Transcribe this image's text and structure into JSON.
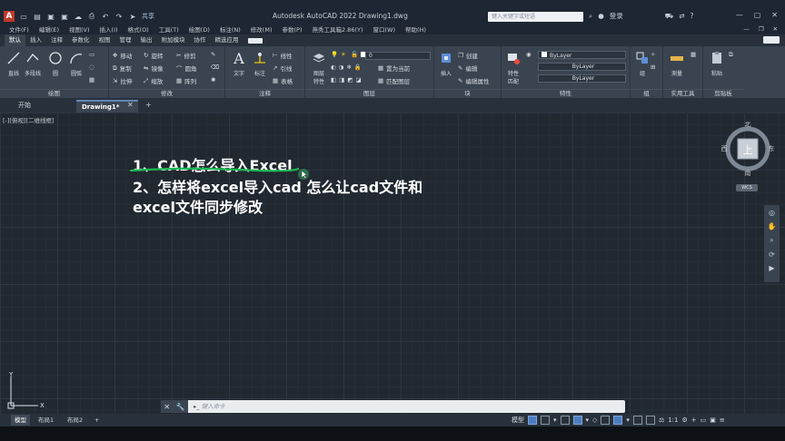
{
  "titlebar": {
    "share": "共享",
    "app_title": "Autodesk AutoCAD 2022   Drawing1.dwg",
    "search_placeholder": "键入关键字或短语",
    "login": "登录",
    "help": "?"
  },
  "menu": [
    "文件(F)",
    "编辑(E)",
    "视图(V)",
    "插入(I)",
    "格式(O)",
    "工具(T)",
    "绘图(D)",
    "标注(N)",
    "修改(M)",
    "参数(P)",
    "燕秀工具箱2.86(Y)",
    "窗口(W)",
    "帮助(H)"
  ],
  "ribbon_tabs": [
    "默认",
    "插入",
    "注释",
    "参数化",
    "视图",
    "管理",
    "输出",
    "附加模块",
    "协作",
    "精选应用"
  ],
  "ribbon": {
    "draw": {
      "title": "绘图",
      "line": "直线",
      "polyline": "多段线",
      "circle": "圆",
      "arc": "圆弧"
    },
    "modify": {
      "title": "修改",
      "move": "移动",
      "rotate": "旋转",
      "trim": "修剪",
      "copy": "复制",
      "mirror": "镜像",
      "fillet": "圆角",
      "stretch": "拉伸",
      "scale": "缩放",
      "array": "阵列"
    },
    "annotation": {
      "title": "注释",
      "text": "文字",
      "dimension": "标注",
      "linear": "线性",
      "leader": "引线",
      "table": "表格"
    },
    "layers": {
      "title": "图层",
      "properties_a": "图层",
      "properties_b": "特性",
      "layer_value": "0",
      "set_current": "置为当前",
      "match_layer": "匹配图层"
    },
    "block": {
      "title": "块",
      "insert": "插入",
      "create": "创建",
      "edit": "编辑",
      "edit_attr": "编辑属性"
    },
    "properties": {
      "title": "特性",
      "match_a": "特性",
      "match_b": "匹配",
      "bylayer1": "ByLayer",
      "bylayer2": "ByLayer",
      "bylayer3": "ByLayer"
    },
    "groups": {
      "title": "组",
      "group": "组"
    },
    "utilities": {
      "title": "实用工具",
      "measure": "测量"
    },
    "clipboard": {
      "title": "剪贴板",
      "paste": "粘贴"
    }
  },
  "doc_tabs": {
    "start": "开始",
    "drawing": "Drawing1*"
  },
  "viewport_label": "[-][俯视][二维线框]",
  "content": {
    "line1": "1、CAD怎么导入Excel",
    "line2": "2、怎样将excel导入cad 怎么让cad文件和",
    "line3": "excel文件同步修改"
  },
  "viewcube": {
    "north": "北",
    "south": "南",
    "east": "东",
    "west": "西",
    "face": "上",
    "wcs": "WCS"
  },
  "ucs": {
    "x": "X",
    "y": "Y"
  },
  "command": {
    "placeholder": "键入命令"
  },
  "layout_tabs": [
    "模型",
    "布局1",
    "布局2"
  ],
  "status": {
    "model": "模型",
    "scale": "1:1"
  },
  "colors": {
    "canvas": "#212830",
    "ribbon": "#3a4450",
    "annotation_green": "#1db954"
  }
}
